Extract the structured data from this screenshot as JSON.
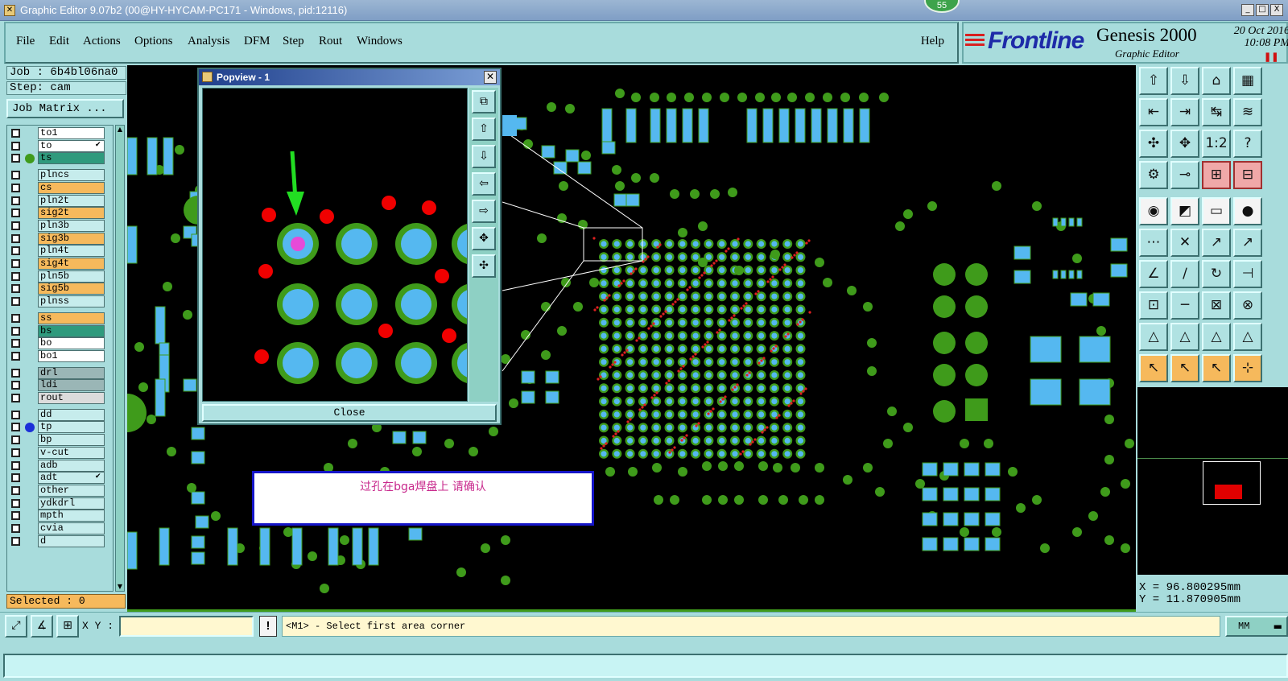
{
  "window": {
    "title": "Graphic Editor 9.07b2 (00@HY-HYCAM-PC171 - Windows, pid:12116)",
    "badge": "55",
    "buttons": [
      "_",
      "□",
      "X"
    ]
  },
  "menu": {
    "items": [
      "File",
      "Edit",
      "Actions",
      "Options",
      "Analysis",
      "DFM",
      "Step",
      "Rout",
      "Windows"
    ],
    "help": "Help"
  },
  "brand": {
    "logo": "Frontline",
    "product": "Genesis 2000",
    "subtitle": "Graphic Editor",
    "date": "20 Oct 2016",
    "time": "10:08 PM",
    "pause_icon": "pause-icon"
  },
  "left": {
    "job": "Job : 6b4bl06na0",
    "step": "Step: cam",
    "job_matrix": "Job Matrix ...",
    "selected": "Selected : 0",
    "layers": [
      {
        "name": "to1",
        "color": "#ffffff",
        "dot": ""
      },
      {
        "name": "to",
        "color": "#ffffff",
        "dot": "",
        "mark": "✔"
      },
      {
        "name": "ts",
        "color": "#2f9a7d",
        "dot": "#3f9b1b"
      },
      {
        "name": "plncs",
        "color": "#c6ecec",
        "dot": "",
        "gap": true
      },
      {
        "name": "cs",
        "color": "#f6b95c",
        "dot": ""
      },
      {
        "name": "pln2t",
        "color": "#c6ecec",
        "dot": ""
      },
      {
        "name": "sig2t",
        "color": "#f6b95c",
        "dot": ""
      },
      {
        "name": "pln3b",
        "color": "#c6ecec",
        "dot": ""
      },
      {
        "name": "sig3b",
        "color": "#f6b95c",
        "dot": ""
      },
      {
        "name": "pln4t",
        "color": "#c6ecec",
        "dot": ""
      },
      {
        "name": "sig4t",
        "color": "#f6b95c",
        "dot": ""
      },
      {
        "name": "pln5b",
        "color": "#c6ecec",
        "dot": ""
      },
      {
        "name": "sig5b",
        "color": "#f6b95c",
        "dot": ""
      },
      {
        "name": "plnss",
        "color": "#c6ecec",
        "dot": ""
      },
      {
        "name": "ss",
        "color": "#f6b95c",
        "dot": "",
        "gap": true
      },
      {
        "name": "bs",
        "color": "#2f9a7d",
        "dot": ""
      },
      {
        "name": "bo",
        "color": "#ffffff",
        "dot": ""
      },
      {
        "name": "bo1",
        "color": "#ffffff",
        "dot": ""
      },
      {
        "name": "drl",
        "color": "#9ab6b6",
        "dot": "",
        "gap": true
      },
      {
        "name": "ldi",
        "color": "#9ab6b6",
        "dot": ""
      },
      {
        "name": "rout",
        "color": "#dcdcdc",
        "dot": ""
      },
      {
        "name": "dd",
        "color": "#c6ecec",
        "dot": "",
        "gap": true
      },
      {
        "name": "tp",
        "color": "#c6ecec",
        "dot": "#1b2fd8"
      },
      {
        "name": "bp",
        "color": "#c6ecec",
        "dot": ""
      },
      {
        "name": "v-cut",
        "color": "#c6ecec",
        "dot": ""
      },
      {
        "name": "adb",
        "color": "#c6ecec",
        "dot": ""
      },
      {
        "name": "adt",
        "color": "#c6ecec",
        "dot": "",
        "mark": "✔"
      },
      {
        "name": "other",
        "color": "#c6ecec",
        "dot": ""
      },
      {
        "name": "ydkdrl",
        "color": "#c6ecec",
        "dot": ""
      },
      {
        "name": "mpth",
        "color": "#c6ecec",
        "dot": ""
      },
      {
        "name": "cvia",
        "color": "#c6ecec",
        "dot": ""
      },
      {
        "name": "d",
        "color": "#c6ecec",
        "dot": ""
      }
    ]
  },
  "popview": {
    "title": "Popview - 1",
    "close": "Close",
    "tools": [
      "zoom-fit-icon",
      "pan-up-icon",
      "pan-down-icon",
      "pan-left-icon",
      "pan-right-icon",
      "zoom-in-icon",
      "zoom-out-icon"
    ]
  },
  "message": {
    "text": "过孔在bga焊盘上 请确认"
  },
  "coords": {
    "x": "X = 96.800295mm",
    "y": "Y = 11.870905mm"
  },
  "bottom": {
    "xy_label": "X Y :",
    "xy_value": "",
    "status": "<M1> - Select first area corner",
    "unit": "MM"
  },
  "right_tools": [
    [
      "⇧",
      "⇩",
      "⌂",
      "▦"
    ],
    [
      "⇤",
      "⇥",
      "↹",
      "≋"
    ],
    [
      "✣",
      "✥",
      "1:2",
      "?"
    ],
    [
      "⚙",
      "⊸",
      "⊞",
      "⊟"
    ],
    [
      "◉",
      "◩",
      "▭",
      "●"
    ],
    [
      "⋯",
      "✕",
      "↗",
      "↗"
    ],
    [
      "∠",
      "∕",
      "↻",
      "⊣"
    ],
    [
      "⊡",
      "─",
      "⊠",
      "⊗"
    ],
    [
      "△",
      "△",
      "△",
      "△"
    ],
    [
      "↖",
      "↖",
      "↖",
      "⊹"
    ]
  ]
}
